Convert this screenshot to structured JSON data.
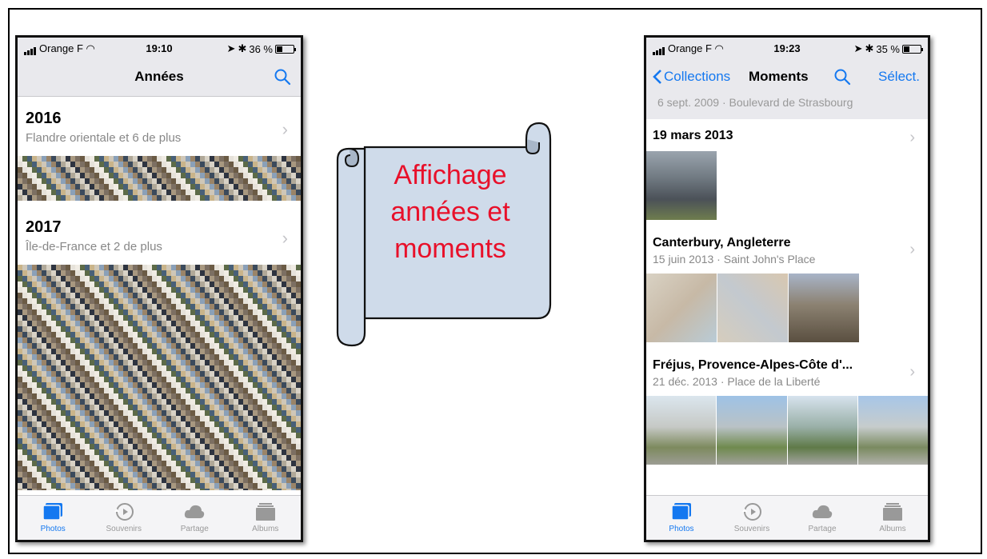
{
  "phone_left": {
    "status": {
      "carrier": "Orange F",
      "time": "19:10",
      "battery": "36 %",
      "battery_level": 0.36
    },
    "nav": {
      "title": "Années"
    },
    "years": [
      {
        "year": "2016",
        "subtitle": "Flandre orientale et 6 de plus"
      },
      {
        "year": "2017",
        "subtitle": "Île-de-France et 2 de plus"
      }
    ],
    "tabs": [
      {
        "label": "Photos",
        "icon": "photos-icon",
        "active": true
      },
      {
        "label": "Souvenirs",
        "icon": "memories-icon",
        "active": false
      },
      {
        "label": "Partage",
        "icon": "cloud-icon",
        "active": false
      },
      {
        "label": "Albums",
        "icon": "albums-icon",
        "active": false
      }
    ]
  },
  "banner": {
    "line1": "Affichage",
    "line2": "années et",
    "line3": "moments"
  },
  "phone_right": {
    "status": {
      "carrier": "Orange F",
      "time": "19:23",
      "battery": "35 %",
      "battery_level": 0.35
    },
    "nav": {
      "back_label": "Collections",
      "title": "Moments",
      "select_label": "Sélect."
    },
    "partial_header": "6 sept. 2009 · Boulevard de Strasbourg",
    "moments": [
      {
        "title": "19 mars 2013",
        "subtitle": ""
      },
      {
        "title": "Canterbury, Angleterre",
        "subtitle": "15 juin 2013 · Saint John's Place"
      },
      {
        "title": "Fréjus, Provence-Alpes-Côte d'...",
        "subtitle": "21 déc. 2013 · Place de la Liberté"
      }
    ],
    "tabs": [
      {
        "label": "Photos",
        "icon": "photos-icon",
        "active": true
      },
      {
        "label": "Souvenirs",
        "icon": "memories-icon",
        "active": false
      },
      {
        "label": "Partage",
        "icon": "cloud-icon",
        "active": false
      },
      {
        "label": "Albums",
        "icon": "albums-icon",
        "active": false
      }
    ]
  },
  "colors": {
    "accent": "#1478f0",
    "banner_fill": "#cfdbea",
    "banner_text": "#e8102a",
    "inactive_tab": "#999999"
  }
}
